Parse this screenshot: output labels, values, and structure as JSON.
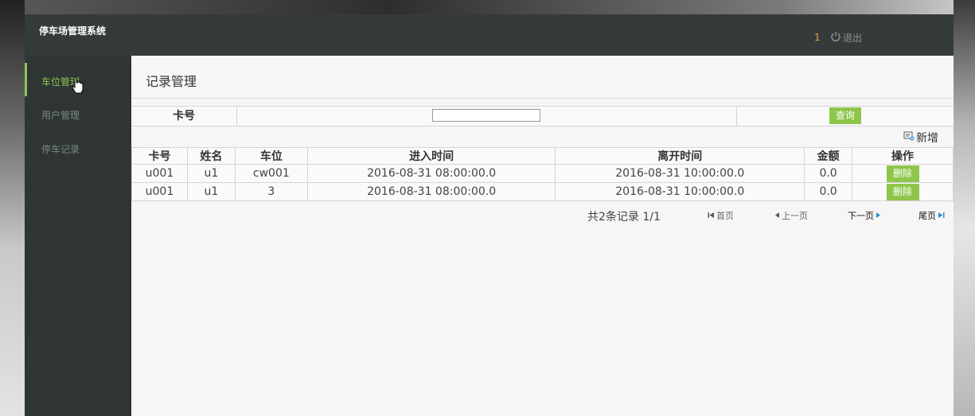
{
  "app": {
    "title": "停车场管理系统",
    "user_id": "1",
    "logout_label": "退出"
  },
  "sidebar": {
    "items": [
      {
        "label": "车位管理",
        "active": true
      },
      {
        "label": "用户管理",
        "active": false
      },
      {
        "label": "停车记录",
        "active": false
      }
    ]
  },
  "main": {
    "title": "记录管理",
    "search": {
      "label": "卡号",
      "value": "",
      "button": "查询"
    },
    "add_label": "新增",
    "table": {
      "headers": [
        "卡号",
        "姓名",
        "车位",
        "进入时间",
        "离开时间",
        "金额",
        "操作"
      ],
      "rows": [
        {
          "card": "u001",
          "name": "u1",
          "space": "cw001",
          "enter": "2016-08-31 08:00:00.0",
          "leave": "2016-08-31 10:00:00.0",
          "amount": "0.0",
          "action": "删除"
        },
        {
          "card": "u001",
          "name": "u1",
          "space": "3",
          "enter": "2016-08-31 08:00:00.0",
          "leave": "2016-08-31 10:00:00.0",
          "amount": "0.0",
          "action": "删除"
        }
      ]
    },
    "pager": {
      "summary": "共2条记录 1/1",
      "first": "首页",
      "prev": "上一页",
      "next": "下一页",
      "last": "尾页"
    }
  },
  "colors": {
    "accent": "#8ec64a",
    "topbar": "#353a3a",
    "sidebar": "#2f3535",
    "user_id": "#e8a33c"
  }
}
